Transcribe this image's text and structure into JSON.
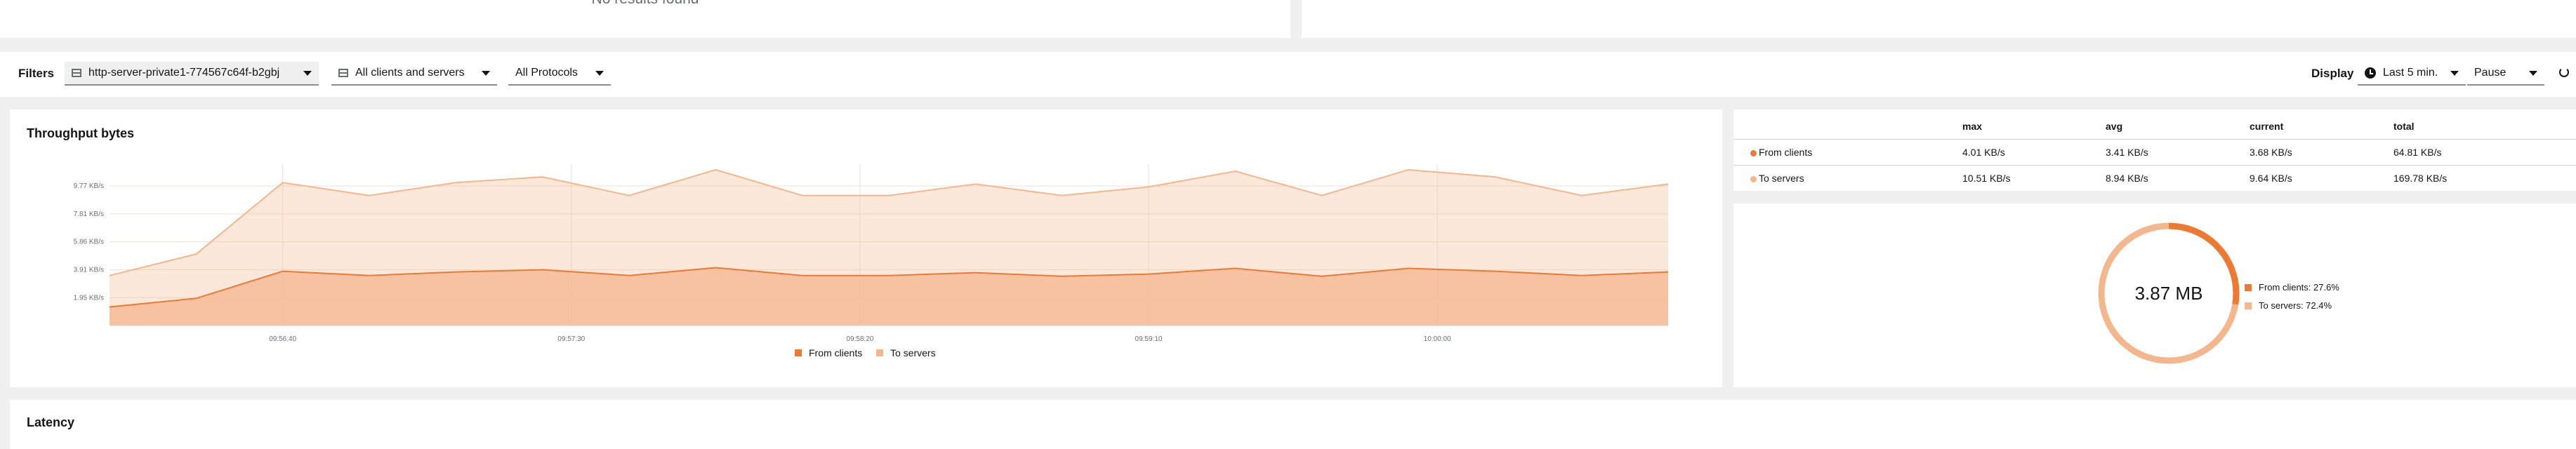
{
  "top": {
    "no_results": "No results found"
  },
  "filters": {
    "label": "Filters",
    "workload": "http-server-private1-774567c64f-b2gbj",
    "scope": "All clients and servers",
    "protocol": "All Protocols",
    "display_label": "Display",
    "time_range": "Last 5 min.",
    "refresh": "Pause"
  },
  "throughput": {
    "title": "Throughput bytes",
    "chart_data": {
      "type": "area",
      "title": "",
      "xlabel": "",
      "ylabel": "",
      "y_ticks": [
        "1.95 KB/s",
        "3.91 KB/s",
        "5.86 KB/s",
        "7.81 KB/s",
        "9.77 KB/s"
      ],
      "y_tick_values": [
        1.95,
        3.91,
        5.86,
        7.81,
        9.77
      ],
      "x_ticks": [
        "09:56:40",
        "09:57:30",
        "09:58:20",
        "09:59:10",
        "10:00:00"
      ],
      "x_tick_index": [
        3,
        8,
        13,
        18,
        23
      ],
      "ylim": [
        0,
        10.8
      ],
      "stacked": true,
      "grid": true,
      "legend_position": "bottom",
      "colors": {
        "from_clients": "#ec7a32",
        "to_servers": "#f4b68d"
      },
      "series": [
        {
          "name": "From clients",
          "values": [
            1.3,
            1.9,
            3.8,
            3.5,
            3.75,
            3.9,
            3.5,
            4.05,
            3.5,
            3.5,
            3.7,
            3.45,
            3.6,
            4.0,
            3.45,
            4.0,
            3.8,
            3.5,
            3.75
          ]
        },
        {
          "name": "To servers",
          "values": [
            3.5,
            5.0,
            10.0,
            9.1,
            10.0,
            10.4,
            9.1,
            10.9,
            9.1,
            9.1,
            9.9,
            9.1,
            9.7,
            10.8,
            9.1,
            10.9,
            10.4,
            9.1,
            9.9
          ]
        }
      ],
      "x_points": 19
    }
  },
  "stats": {
    "headers": [
      "max",
      "avg",
      "current",
      "total"
    ],
    "rows": [
      {
        "label": "From clients",
        "color": "#ec7a32",
        "values": [
          "4.01 KB/s",
          "3.41 KB/s",
          "3.68 KB/s",
          "64.81 KB/s"
        ]
      },
      {
        "label": "To servers",
        "color": "#f4b68d",
        "values": [
          "10.51 KB/s",
          "8.94 KB/s",
          "9.64 KB/s",
          "169.78 KB/s"
        ]
      }
    ]
  },
  "donut": {
    "center": "3.87 MB",
    "chart_data": {
      "type": "pie",
      "values": [
        27.6,
        72.4
      ],
      "labels": [
        "From clients: 27.6%",
        "To servers: 72.4%"
      ],
      "colors": [
        "#ec7a32",
        "#f4b68d"
      ]
    }
  },
  "latency": {
    "title": "Latency"
  }
}
